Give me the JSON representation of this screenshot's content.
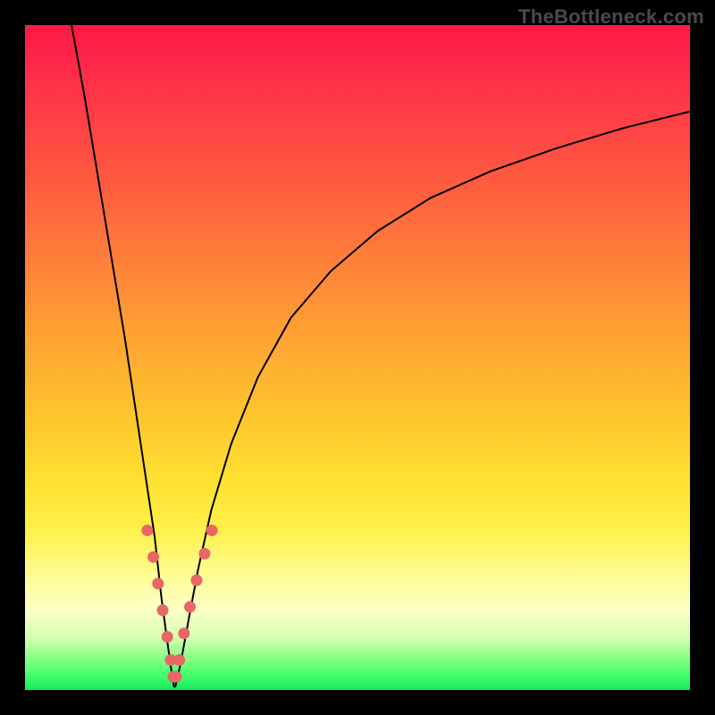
{
  "watermark": "TheBottleneck.com",
  "colors": {
    "frame": "#000000",
    "curve": "#000000",
    "marker": "#e86666",
    "gradient_top": "#ff1846",
    "gradient_bottom": "#18e85c"
  },
  "chart_data": {
    "type": "line",
    "title": "",
    "xlabel": "",
    "ylabel": "",
    "xlim": [
      0,
      100
    ],
    "ylim": [
      0,
      100
    ],
    "grid": false,
    "legend": false,
    "note": "No numeric tick labels are shown; x/y values are estimated as percentages of the plot area (0 = left/bottom, 100 = right/top).",
    "series": [
      {
        "name": "left-branch",
        "x": [
          7,
          9,
          11,
          13,
          15,
          16.5,
          18,
          19.5,
          20.5,
          21.3,
          22,
          22.4
        ],
        "y": [
          100,
          89,
          77,
          65,
          53,
          43,
          33,
          23,
          14,
          8,
          3,
          0.5
        ]
      },
      {
        "name": "right-branch",
        "x": [
          22.6,
          23.4,
          24.5,
          26,
          28,
          31,
          35,
          40,
          46,
          53,
          61,
          70,
          80,
          90,
          100
        ],
        "y": [
          0.5,
          4,
          10,
          18,
          27,
          37,
          47,
          56,
          63,
          69,
          74,
          78,
          81.5,
          84.5,
          87
        ]
      }
    ],
    "markers": {
      "name": "highlight-dots",
      "note": "Pale-red dots clustered around the valley, roughly along both branches between y≈7 and y≈24.",
      "x": [
        18.4,
        19.3,
        20.0,
        20.7,
        21.4,
        21.9,
        22.3,
        22.7,
        23.2,
        23.9,
        24.8,
        25.8,
        27.0,
        28.1
      ],
      "y": [
        24.0,
        20.0,
        16.0,
        12.0,
        8.0,
        4.5,
        2.0,
        2.0,
        4.5,
        8.5,
        12.5,
        16.5,
        20.5,
        24.0
      ]
    }
  }
}
